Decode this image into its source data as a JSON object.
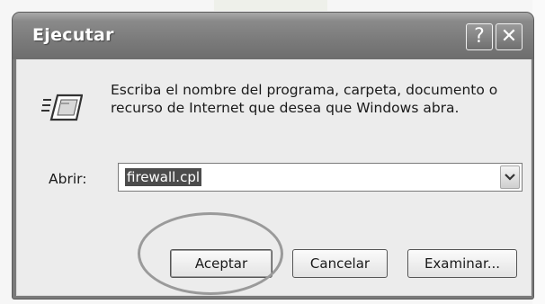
{
  "window": {
    "title": "Ejecutar",
    "help_glyph": "?",
    "close_glyph": "✕"
  },
  "dialog": {
    "description": "Escriba el nombre del programa, carpeta, documento o recurso de Internet que desea que Windows abra.",
    "open_label": "Abrir:",
    "open_value": "firewall.cpl",
    "buttons": {
      "ok": "Aceptar",
      "cancel": "Cancelar",
      "browse": "Examinar..."
    }
  },
  "icons": {
    "run": "run-program-icon",
    "dropdown": "chevron-down-icon",
    "help": "help-icon",
    "close": "close-icon"
  },
  "colors": {
    "title_bar": "#7c7c7c",
    "dialog_background": "#ececec",
    "selection": "#4c4c4c",
    "annotation_ring": "#9a9a9a"
  }
}
